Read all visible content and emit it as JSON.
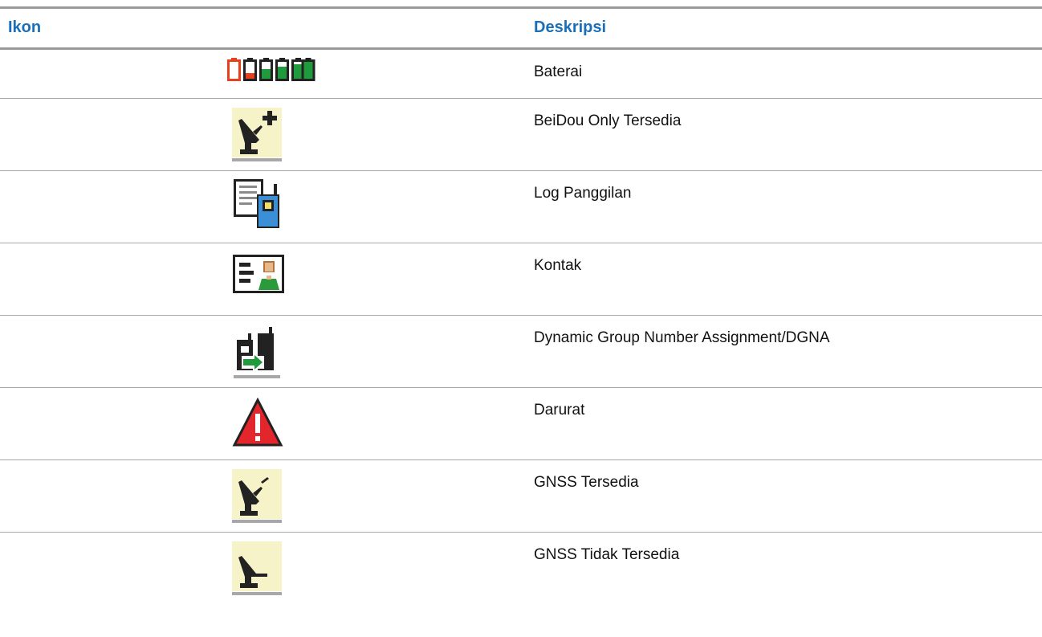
{
  "table": {
    "headers": {
      "icon": "Ikon",
      "description": "Deskripsi"
    },
    "rows": [
      {
        "icon": "battery-levels-icon",
        "description": "Baterai"
      },
      {
        "icon": "beidou-only-available-icon",
        "description": "BeiDou Only Tersedia"
      },
      {
        "icon": "call-log-icon",
        "description": "Log Panggilan"
      },
      {
        "icon": "contact-card-icon",
        "description": "Kontak"
      },
      {
        "icon": "dgna-icon",
        "description": "Dynamic Group Number Assignment/DGNA"
      },
      {
        "icon": "emergency-warning-icon",
        "description": "Darurat"
      },
      {
        "icon": "gnss-available-icon",
        "description": "GNSS Tersedia"
      },
      {
        "icon": "gnss-unavailable-icon",
        "description": "GNSS Tidak Tersedia"
      }
    ]
  },
  "colors": {
    "header_text": "#1a6fb8",
    "rule": "#9a9a9a",
    "battery_red": "#e8401c",
    "battery_green": "#1f9a3c",
    "icon_bg_cream": "#f7f3c8",
    "radio_blue": "#3a8fd6",
    "emergency_red": "#e3262c",
    "arrow_green": "#1f9a3c"
  }
}
